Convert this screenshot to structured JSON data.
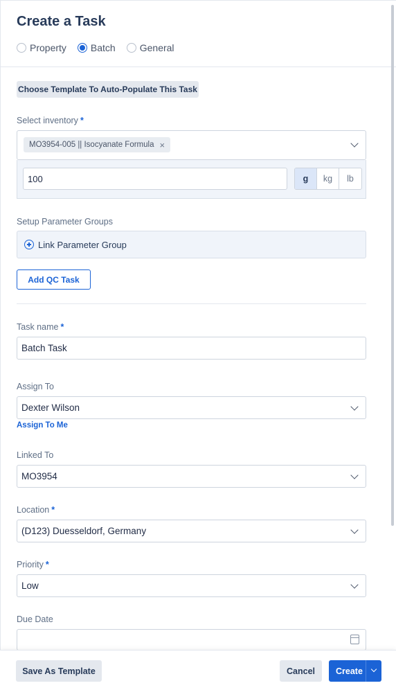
{
  "form": {
    "title": "Create a Task",
    "type_options": [
      {
        "label": "Property",
        "selected": false
      },
      {
        "label": "Batch",
        "selected": true
      },
      {
        "label": "General",
        "selected": false
      }
    ],
    "template_button": "Choose Template To Auto-Populate This Task",
    "inventory": {
      "label": "Select inventory",
      "required_mark": "*",
      "selected_chip": "MO3954-005 || Isocyanate Formula",
      "chip_remove": "×",
      "quantity_value": "100",
      "units": [
        "g",
        "kg",
        "lb"
      ],
      "selected_unit": "g"
    },
    "parameter_groups": {
      "label": "Setup Parameter Groups",
      "link_label": "Link Parameter Group"
    },
    "qc_button": "Add QC Task",
    "task_name": {
      "label": "Task name",
      "required_mark": "*",
      "value": "Batch Task"
    },
    "assign_to": {
      "label": "Assign To",
      "value": "Dexter Wilson",
      "assign_me_link": "Assign To Me"
    },
    "linked_to": {
      "label": "Linked To",
      "value": "MO3954"
    },
    "location": {
      "label": "Location",
      "required_mark": "*",
      "value": "(D123) Duesseldorf, Germany"
    },
    "priority": {
      "label": "Priority",
      "required_mark": "*",
      "value": "Low"
    },
    "due_date": {
      "label": "Due Date",
      "value": ""
    }
  },
  "footer": {
    "save_template": "Save As Template",
    "cancel": "Cancel",
    "create": "Create"
  },
  "colors": {
    "accent": "#1b63d6",
    "title": "#283b5a",
    "muted_label": "#5f6f86"
  },
  "icons": [
    "radio-icon",
    "close-icon",
    "chevron-down-icon",
    "plus-circle-icon",
    "calendar-icon"
  ]
}
